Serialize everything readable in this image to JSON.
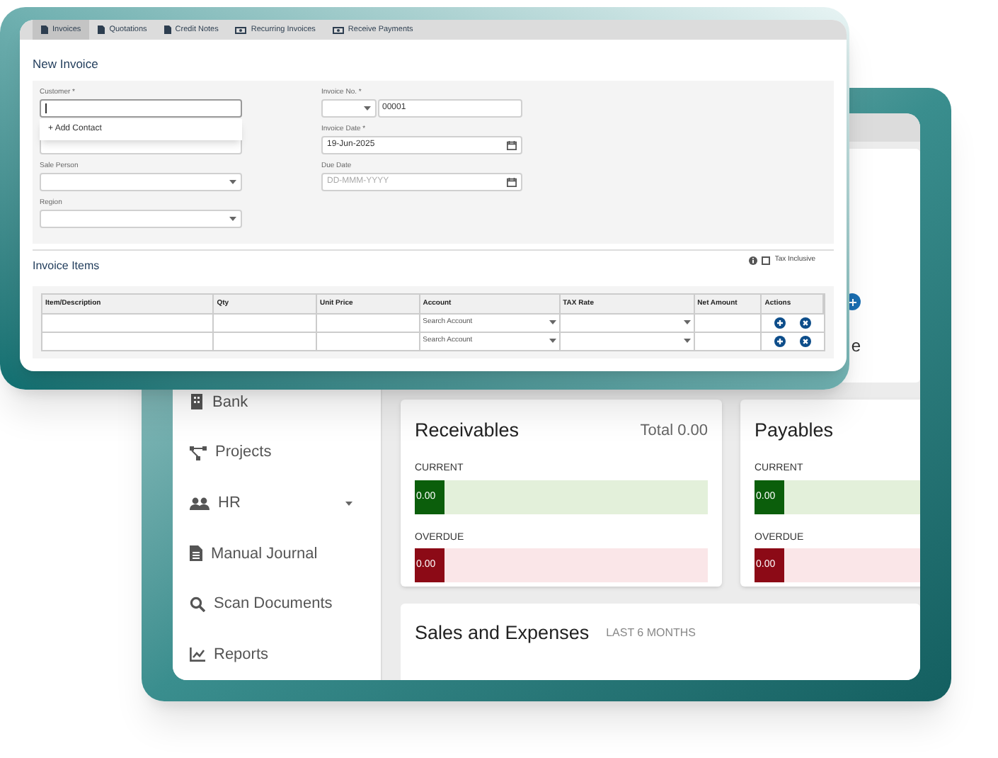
{
  "back_window": {
    "sidebar": {
      "items": [
        {
          "label": "Bank",
          "kind": "bank",
          "expandable": false
        },
        {
          "label": "Projects",
          "kind": "projects",
          "expandable": false
        },
        {
          "label": "HR",
          "kind": "hr",
          "expandable": true
        },
        {
          "label": "Manual Journal",
          "kind": "journal",
          "expandable": false
        },
        {
          "label": "Scan Documents",
          "kind": "scan",
          "expandable": false
        },
        {
          "label": "Reports",
          "kind": "reports",
          "expandable": false
        }
      ]
    },
    "top_card": {
      "heading_fragment": "e"
    },
    "summary_cards": [
      {
        "title": "Receivables",
        "total": "Total 0.00",
        "rows": [
          {
            "label": "CURRENT",
            "value": "0.00",
            "kind": "current"
          },
          {
            "label": "OVERDUE",
            "value": "0.00",
            "kind": "overdue"
          }
        ]
      },
      {
        "title": "Payables",
        "rows": [
          {
            "label": "CURRENT",
            "value": "0.00",
            "kind": "current"
          },
          {
            "label": "OVERDUE",
            "value": "0.00",
            "kind": "overdue"
          }
        ]
      }
    ],
    "sales_card": {
      "title": "Sales and Expenses",
      "subtitle": "LAST 6 MONTHS"
    }
  },
  "front_window": {
    "tabs": [
      {
        "label": "Invoices",
        "selected": true
      },
      {
        "label": "Quotations",
        "selected": false
      },
      {
        "label": "Credit Notes",
        "selected": false
      },
      {
        "label": "Recurring Invoices",
        "selected": false
      },
      {
        "label": "Receive Payments",
        "selected": false
      }
    ],
    "title": "New Invoice",
    "left_fields": [
      {
        "label": "Customer *",
        "kind": "text",
        "focused": true
      },
      {
        "label": "Sale Person",
        "kind": "select"
      },
      {
        "label": "Region",
        "kind": "select"
      }
    ],
    "customer_menu": {
      "items": [
        "+ Add Contact"
      ]
    },
    "invoice_no": {
      "label": "Invoice No. *",
      "value": "00001"
    },
    "right_fields": [
      {
        "label": "Invoice Date *",
        "kind": "date",
        "value": "19-Jun-2025"
      },
      {
        "label": "Due Date",
        "kind": "date",
        "placeholder": "DD-MMM-YYYY"
      }
    ],
    "items_title": "Invoice Items",
    "tax_inclusive": {
      "label": "Tax Inclusive",
      "checked": false
    },
    "table": {
      "columns": [
        "Item/Description",
        "Qty",
        "Unit Price",
        "Account",
        "TAX Rate",
        "Net Amount",
        "Actions"
      ],
      "rows": [
        {
          "account": {
            "placeholder": "Search Account"
          }
        },
        {
          "account": {
            "placeholder": "Search Account"
          }
        }
      ]
    }
  }
}
